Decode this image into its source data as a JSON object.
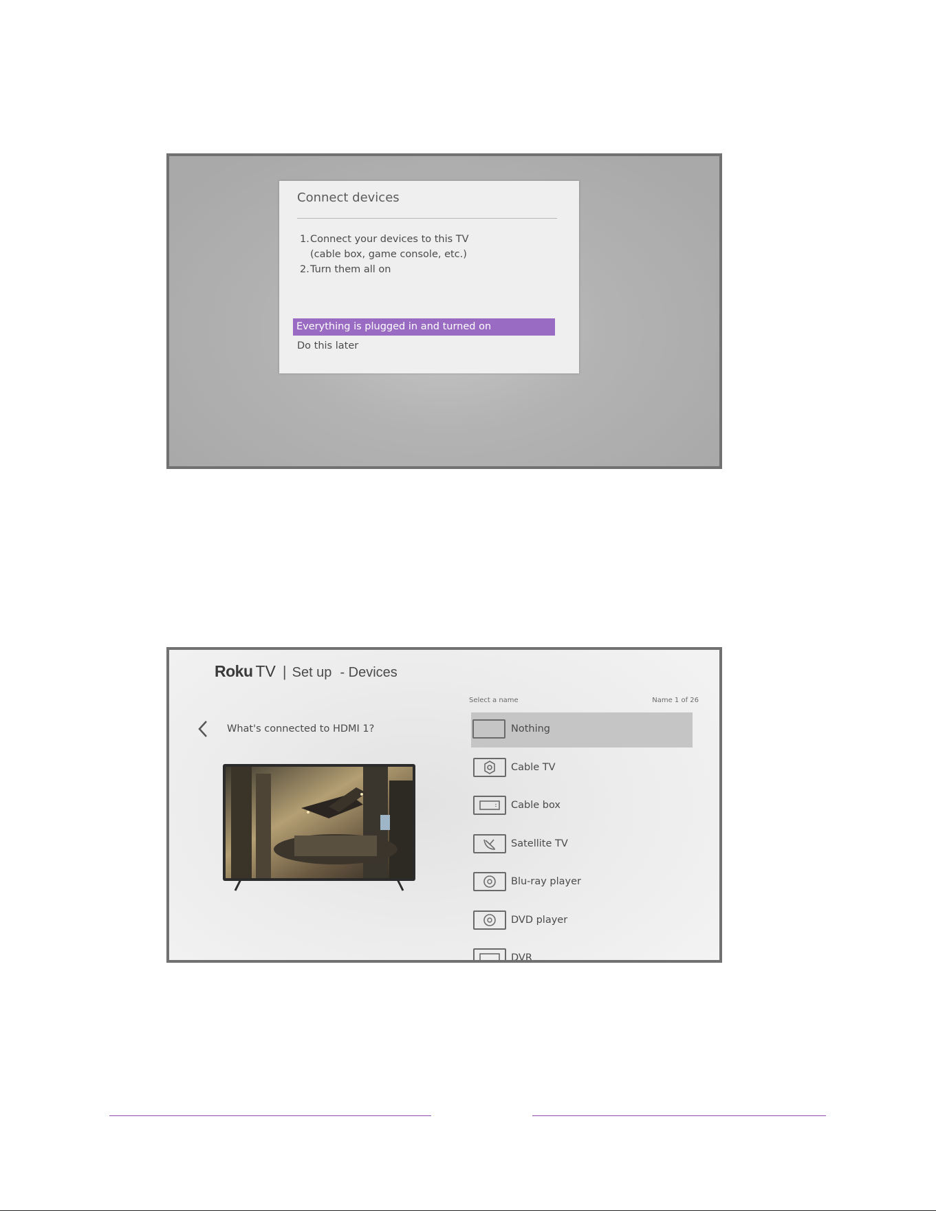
{
  "screen1": {
    "dialog_title": "Connect devices",
    "steps": [
      {
        "num": "1.",
        "lines": [
          "Connect your devices to this TV",
          "(cable box, game console, etc.)"
        ]
      },
      {
        "num": "2.",
        "lines": [
          "Turn them all on"
        ]
      }
    ],
    "option_primary": "Everything is plugged in and turned on",
    "option_secondary": "Do this later",
    "accent_color": "#9a6bc2"
  },
  "screen2": {
    "header": {
      "logo_brand": "Roku",
      "logo_tv": "TV",
      "separator": "|",
      "section": "Set up",
      "subsection": "- Devices"
    },
    "question": "What's connected to HDMI 1?",
    "list_caption": "Select a name",
    "list_counter": "Name 1 of 26",
    "items": [
      {
        "label": "Nothing",
        "icon": "blank-icon"
      },
      {
        "label": "Cable TV",
        "icon": "cable-tv-icon"
      },
      {
        "label": "Cable box",
        "icon": "cable-box-icon"
      },
      {
        "label": "Satellite TV",
        "icon": "satellite-dish-icon"
      },
      {
        "label": "Blu-ray player",
        "icon": "disc-icon"
      },
      {
        "label": "DVD player",
        "icon": "disc-icon"
      },
      {
        "label": "DVR",
        "icon": "dvr-icon"
      }
    ]
  },
  "footer": {
    "rule_color": "#8b4ab0"
  }
}
